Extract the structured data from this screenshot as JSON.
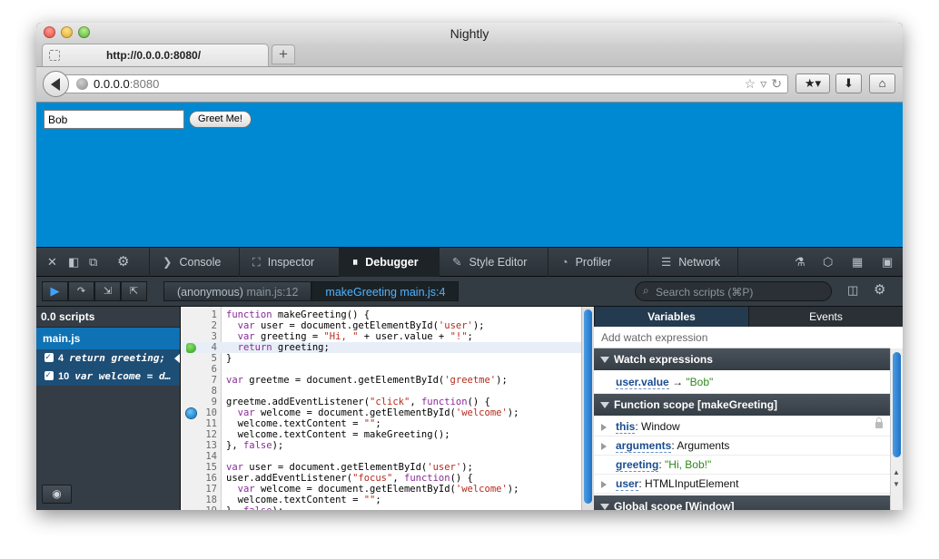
{
  "window": {
    "title": "Nightly"
  },
  "tab": {
    "title": "http://0.0.0.0:8080/",
    "new_tab_label": "+"
  },
  "urlbar": {
    "host": "0.0.0.0",
    "port": ":8080"
  },
  "page": {
    "name_value": "Bob",
    "greet_button": "Greet Me!"
  },
  "devtools": {
    "tabs": [
      {
        "label": "Console",
        "icon": "console-icon",
        "glyph": "❯"
      },
      {
        "label": "Inspector",
        "icon": "inspector-icon",
        "glyph": "⛶"
      },
      {
        "label": "Debugger",
        "icon": "debugger-icon",
        "glyph": "⏸"
      },
      {
        "label": "Style Editor",
        "icon": "style-editor-icon",
        "glyph": "✎"
      },
      {
        "label": "Profiler",
        "icon": "profiler-icon",
        "glyph": "◔"
      },
      {
        "label": "Network",
        "icon": "network-icon",
        "glyph": "☰"
      }
    ],
    "selected_tab": "Debugger"
  },
  "debugger": {
    "frames": [
      {
        "func": "(anonymous)",
        "loc": "main.js:12"
      },
      {
        "func": "makeGreeting",
        "loc": "main.js:4"
      }
    ],
    "search_placeholder": "Search scripts (⌘P)",
    "scripts_header": "0.0 scripts",
    "script_file": "main.js",
    "breakpoints": [
      {
        "line": "4",
        "text": "return greeting;"
      },
      {
        "line": "10",
        "text": "var welcome = d…"
      }
    ],
    "source_lines": [
      "function makeGreeting() {",
      "  var user = document.getElementById('user');",
      "  var greeting = \"Hi, \" + user.value + \"!\";",
      "  return greeting;",
      "}",
      "",
      "var greetme = document.getElementById('greetme');",
      "",
      "greetme.addEventListener(\"click\", function() {",
      "  var welcome = document.getElementById('welcome');",
      "  welcome.textContent = \"\";",
      "  welcome.textContent = makeGreeting();",
      "}, false);",
      "",
      "var user = document.getElementById('user');",
      "user.addEventListener(\"focus\", function() {",
      "  var welcome = document.getElementById('welcome');",
      "  welcome.textContent = \"\";",
      "}, false);"
    ],
    "current_line": 4,
    "breakpoint_line": 10
  },
  "variables": {
    "tabs": [
      "Variables",
      "Events"
    ],
    "watch_placeholder": "Add watch expression",
    "watch_header": "Watch expressions",
    "watch_item": {
      "expr": "user.value",
      "arrow": "→",
      "value": "\"Bob\""
    },
    "function_scope_header": "Function scope [makeGreeting]",
    "vars": [
      {
        "name": "this",
        "value": "Window"
      },
      {
        "name": "arguments",
        "value": "Arguments"
      },
      {
        "name": "greeting",
        "value": "\"Hi, Bob!\""
      },
      {
        "name": "user",
        "value": "HTMLInputElement"
      }
    ],
    "global_scope_header": "Global scope [Window]"
  }
}
